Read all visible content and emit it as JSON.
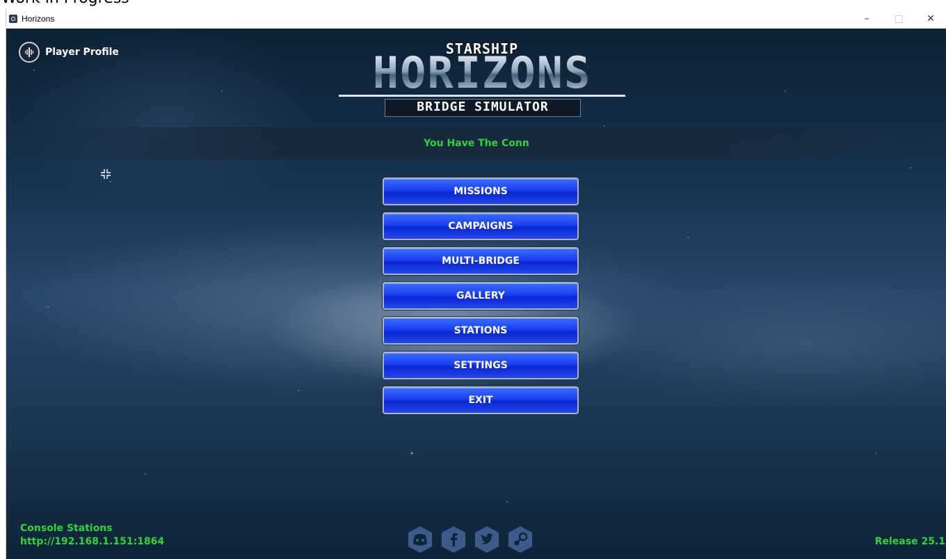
{
  "banner": {
    "text": "Work in Progress"
  },
  "window": {
    "title": "Horizons",
    "minimize_glyph": "–",
    "maximize_glyph": "□",
    "close_glyph": "✕"
  },
  "player_profile": {
    "label": "Player Profile",
    "icon": "player-emblem-icon"
  },
  "logo": {
    "line1": "STARSHIP",
    "line2": "HORIZONS",
    "line3": "BRIDGE SIMULATOR"
  },
  "status": {
    "conn_text": "You Have The Conn"
  },
  "menu": {
    "items": [
      {
        "label": "MISSIONS"
      },
      {
        "label": "CAMPAIGNS"
      },
      {
        "label": "MULTI-BRIDGE"
      },
      {
        "label": "GALLERY"
      },
      {
        "label": "STATIONS"
      },
      {
        "label": "SETTINGS"
      },
      {
        "label": "EXIT"
      }
    ]
  },
  "footer": {
    "console_title": "Console Stations",
    "console_url": "http://192.168.1.151:1864",
    "release": "Release 25.1",
    "social": [
      "discord-icon",
      "facebook-icon",
      "twitter-icon",
      "steam-icon"
    ]
  },
  "colors": {
    "accent_green": "#2fd43a",
    "button_blue": "#1a3ff2",
    "icon_fill": "#3c5a8c"
  }
}
